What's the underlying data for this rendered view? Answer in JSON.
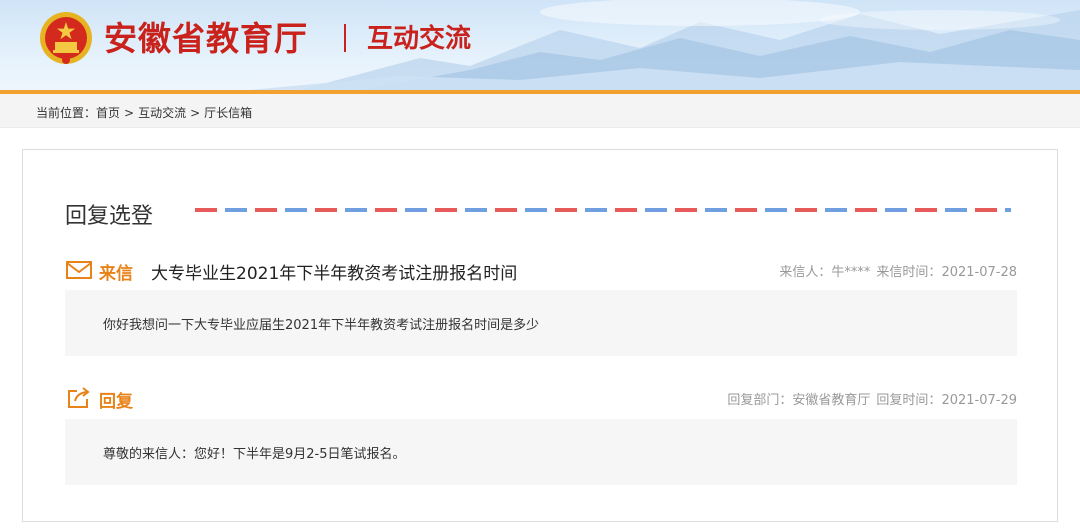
{
  "header": {
    "site_name": "安徽省教育厅",
    "section_name": "互动交流",
    "colors": {
      "brand_red": "#c9221c",
      "accent_orange": "#f2a12e",
      "sky": "#d6e8f8"
    },
    "emblem_icon": "national-emblem-icon"
  },
  "breadcrumb": {
    "prefix": "当前位置：",
    "items": [
      "首页",
      "互动交流",
      "厅长信箱"
    ],
    "separator": ">"
  },
  "panel": {
    "heading": "回复选登",
    "letter": {
      "icon": "envelope-icon",
      "tag": "来信",
      "subject": "大专毕业生2021年下半年教资考试注册报名时间",
      "sender_label": "来信人：",
      "sender": "牛****",
      "time_label": "来信时间：",
      "time": "2021-07-28",
      "body": "你好我想问一下大专毕业应届生2021年下半年教资考试注册报名时间是多少"
    },
    "reply": {
      "icon": "reply-share-icon",
      "tag": "回复",
      "dept_label": "回复部门：",
      "dept": "安徽省教育厅",
      "time_label": "回复时间：",
      "time": "2021-07-29",
      "body": "尊敬的来信人：您好！下半年是9月2-5日笔试报名。"
    }
  }
}
